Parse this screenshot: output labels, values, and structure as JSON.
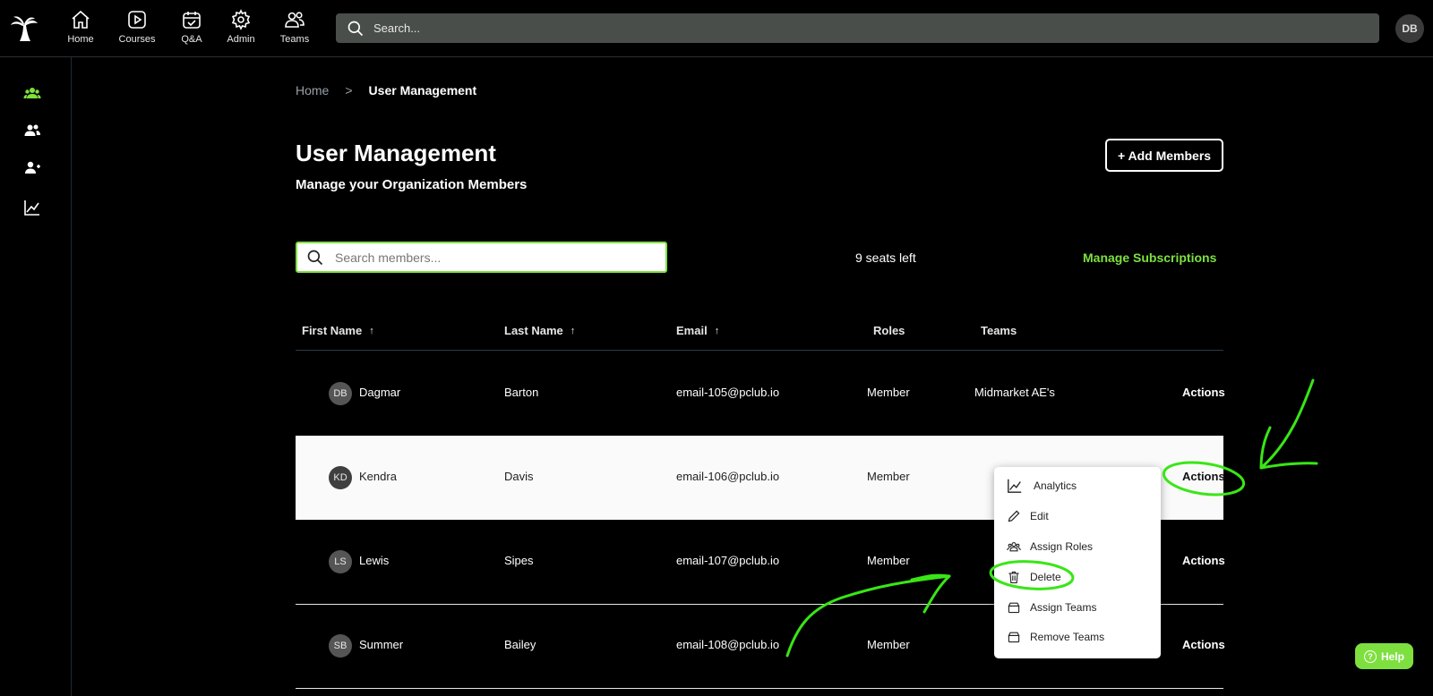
{
  "topnav": {
    "items": [
      {
        "label": "Home",
        "icon": "home-icon"
      },
      {
        "label": "Courses",
        "icon": "play-icon"
      },
      {
        "label": "Q&A",
        "icon": "calendar-check-icon"
      },
      {
        "label": "Admin",
        "icon": "gear-icon"
      },
      {
        "label": "Teams",
        "icon": "users-icon"
      }
    ],
    "search_placeholder": "Search...",
    "user_initials": "DB"
  },
  "breadcrumb": {
    "home": "Home",
    "separator": ">",
    "current": "User Management"
  },
  "page": {
    "title": "User Management",
    "subtitle": "Manage your Organization Members",
    "add_button": "+ Add Members"
  },
  "toolbar": {
    "search_placeholder": "Search members...",
    "seats_left": "9 seats left",
    "manage_subscriptions": "Manage Subscriptions"
  },
  "table": {
    "headers": {
      "first_name": "First Name",
      "last_name": "Last Name",
      "email": "Email",
      "roles": "Roles",
      "teams": "Teams",
      "sort_arrow": "↑"
    },
    "rows": [
      {
        "initials": "DB",
        "first": "Dagmar",
        "last": "Barton",
        "email": "email-105@pclub.io",
        "role": "Member",
        "team": "Midmarket AE's",
        "actions": "Actions"
      },
      {
        "initials": "KD",
        "first": "Kendra",
        "last": "Davis",
        "email": "email-106@pclub.io",
        "role": "Member",
        "team": "",
        "actions": "Actions"
      },
      {
        "initials": "LS",
        "first": "Lewis",
        "last": "Sipes",
        "email": "email-107@pclub.io",
        "role": "Member",
        "team": "",
        "actions": "Actions"
      },
      {
        "initials": "SB",
        "first": "Summer",
        "last": "Bailey",
        "email": "email-108@pclub.io",
        "role": "Member",
        "team": "",
        "actions": "Actions"
      }
    ]
  },
  "menu": {
    "items": [
      {
        "label": "Analytics",
        "icon": "chart-icon"
      },
      {
        "label": "Edit",
        "icon": "pencil-icon"
      },
      {
        "label": "Assign Roles",
        "icon": "users-cog-icon"
      },
      {
        "label": "Delete",
        "icon": "trash-icon"
      },
      {
        "label": "Assign Teams",
        "icon": "box-icon"
      },
      {
        "label": "Remove Teams",
        "icon": "box-icon"
      }
    ]
  },
  "help": {
    "label": "Help"
  },
  "colors": {
    "accent": "#7ee03f",
    "search_bg": "#4a4e4b",
    "highlight_row": "#fafafa"
  }
}
